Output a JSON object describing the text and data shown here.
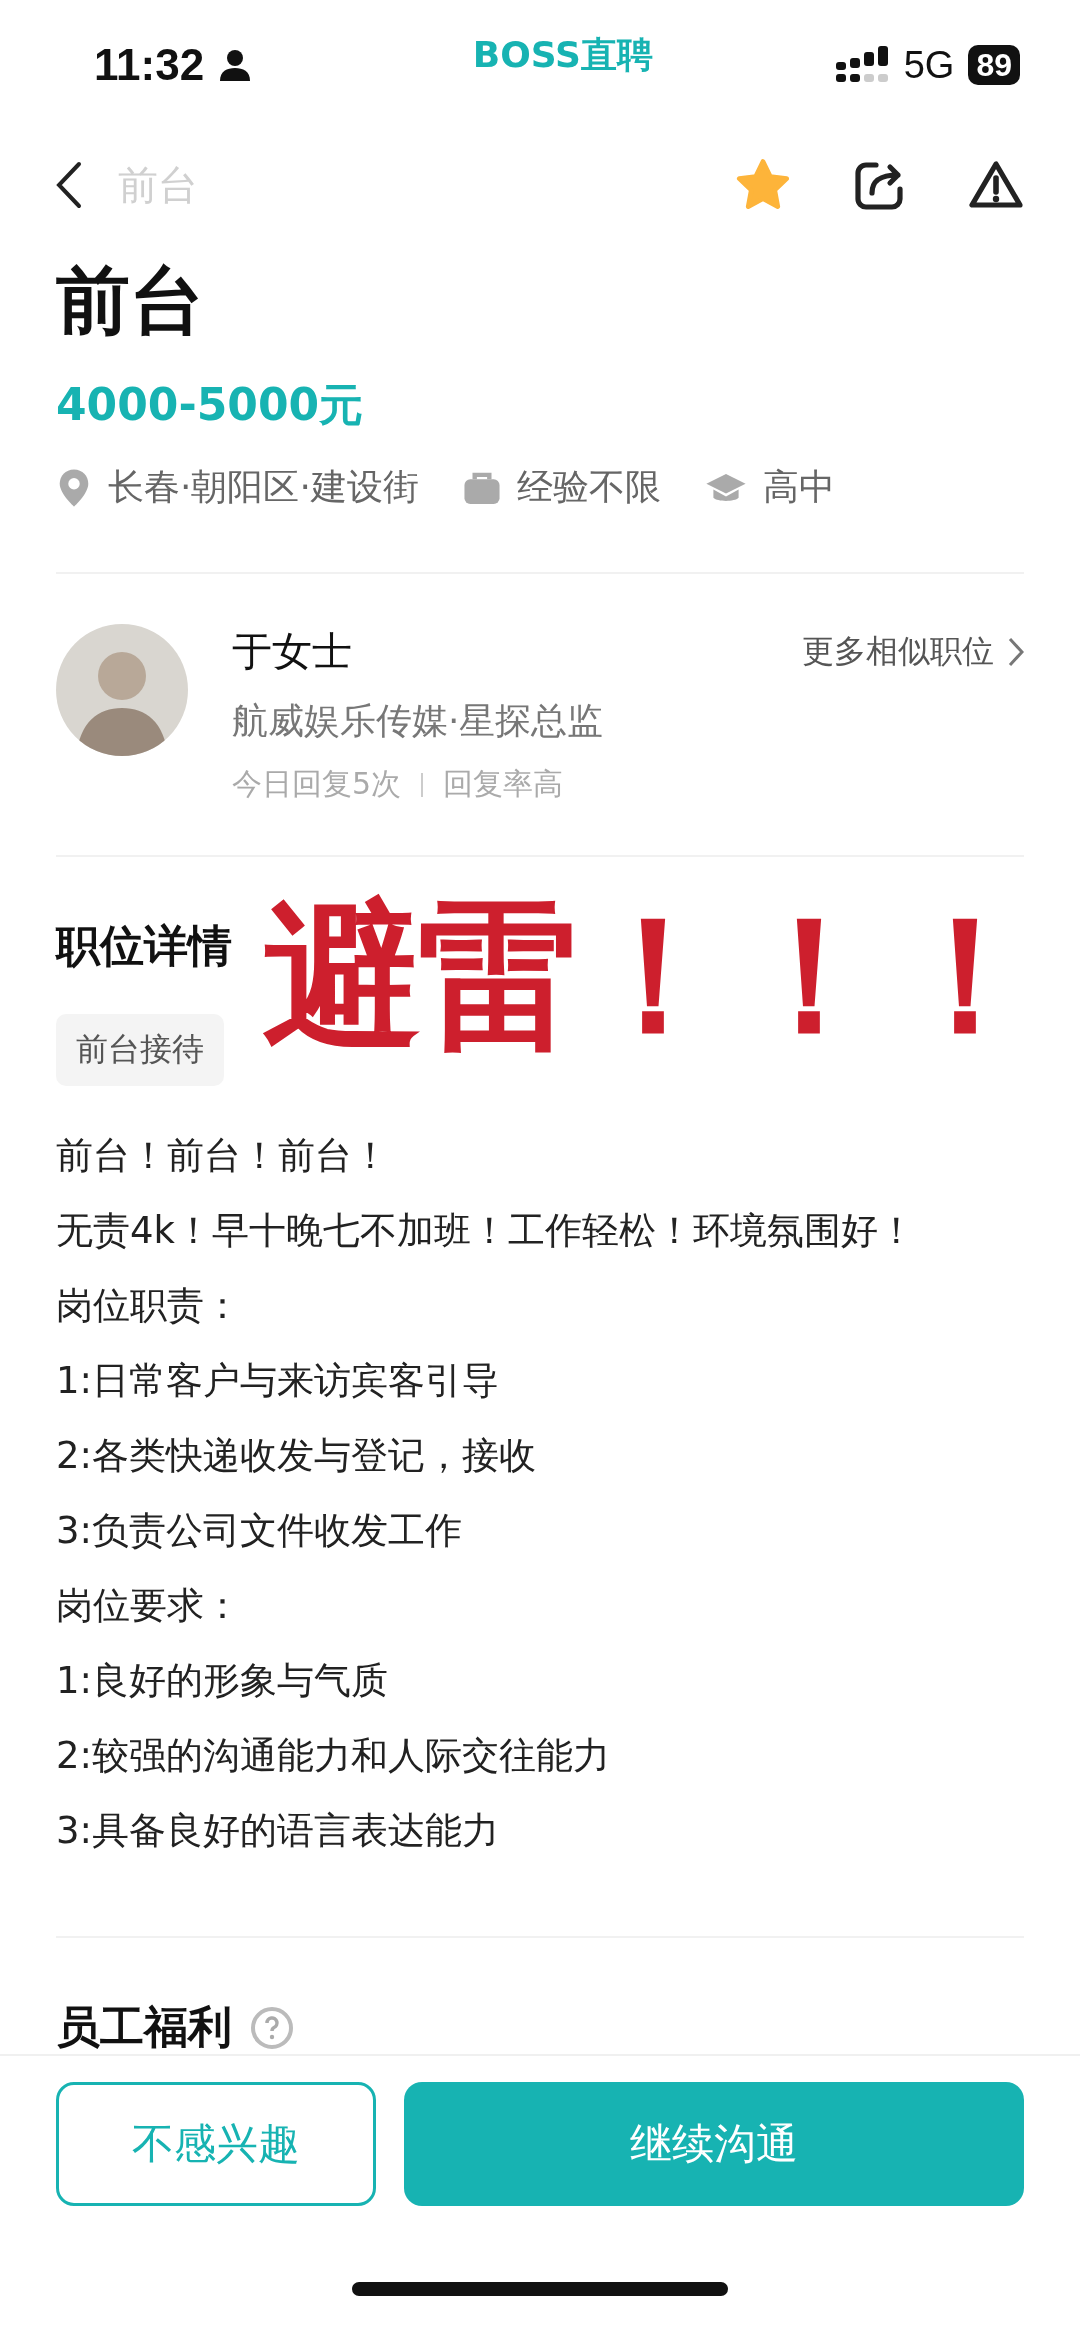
{
  "status_bar": {
    "time": "11:32",
    "app_name": "BOSS直聘",
    "network": "5G",
    "battery": "89"
  },
  "nav": {
    "title": "前台",
    "favorited": true
  },
  "job": {
    "title": "前台",
    "salary": "4000-5000元",
    "tags": [
      {
        "kind": "location",
        "text": "长春·朝阳区·建设街"
      },
      {
        "kind": "experience",
        "text": "经验不限"
      },
      {
        "kind": "education",
        "text": "高中"
      }
    ]
  },
  "recruiter": {
    "name": "于女士",
    "company": "航威娱乐传媒·星探总监",
    "replies": "今日回复5次",
    "reply_rate": "回复率高",
    "more_link": "更多相似职位"
  },
  "details": {
    "heading": "职位详情",
    "skill_tags": [
      "前台接待"
    ],
    "lines": [
      "前台！前台！前台！",
      "无责4k！早十晚七不加班！工作轻松！环境氛围好！",
      "岗位职责：",
      "1:日常客户与来访宾客引导",
      "2:各类快递收发与登记，接收",
      "3:负责公司文件收发工作",
      "岗位要求：",
      "1:良好的形象与气质",
      "2:较强的沟通能力和人际交往能力",
      "3:具备良好的语言表达能力"
    ]
  },
  "overlay": {
    "text": "避雷！！！"
  },
  "benefits": {
    "heading": "员工福利"
  },
  "actions": [
    {
      "kind": "secondary",
      "label": "不感兴趣"
    },
    {
      "kind": "primary",
      "label": "继续沟通"
    }
  ]
}
